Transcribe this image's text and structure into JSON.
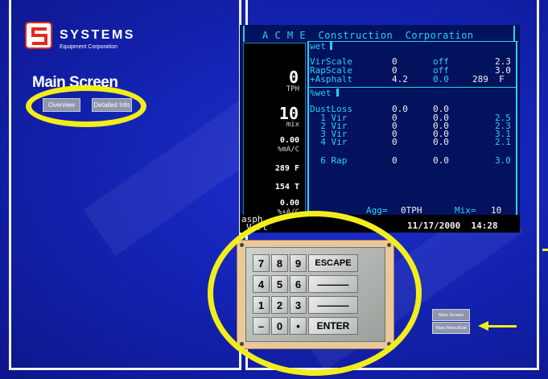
{
  "brand": {
    "name": "SYSTEMS",
    "tagline": "Equipment Corporation",
    "color": "#e12a1f"
  },
  "page_title": "Main Screen",
  "nav": {
    "overview": "Overview",
    "detailed": "Detailed Info"
  },
  "terminal": {
    "header": "A C M E  Construction  Corporation",
    "wet1": "wet",
    "wet2": "%wet",
    "rows_top": [
      {
        "name": "VirScale",
        "v1": "0",
        "v2": "off",
        "v3": "2.3"
      },
      {
        "name": "RapScale",
        "v1": "0",
        "v2": "off",
        "v3": "3.0"
      },
      {
        "name": "+Asphalt",
        "v1": "4.2",
        "v2": "0.0",
        "v3": "289  F"
      }
    ],
    "rows_bottom": [
      {
        "name": "DustLoss",
        "v1": "0.0",
        "v2": "0.0",
        "v3": ""
      },
      {
        "name": "  1 Vir",
        "v1": "0",
        "v2": "0.0",
        "v3": "2.5"
      },
      {
        "name": "  2 Vir",
        "v1": "0",
        "v2": "0.0",
        "v3": "2.3"
      },
      {
        "name": "  3 Vir",
        "v1": "0",
        "v2": "0.0",
        "v3": "3.1"
      },
      {
        "name": "  4 Vir",
        "v1": "0",
        "v2": "0.0",
        "v3": "2.1"
      },
      {
        "name": "  6 Rap",
        "v1": "0",
        "v2": "0.0",
        "v3": "3.0"
      }
    ],
    "left_panel": {
      "tph_value": "0",
      "tph_label": "TPH",
      "mix_value": "10",
      "mix_label": "mix",
      "mac_value": "0.00",
      "mac_label": "%mA/C",
      "temp": "289 F",
      "tons": "154 T",
      "ac_value": "0.00",
      "ac_label": "%+A/C"
    },
    "agg_label": "Agg=",
    "agg_value": "0TPH",
    "mix_label": "Mix=",
    "mix_value": "10",
    "status_left1": "asph",
    "status_left2": "Vert",
    "datetime": "11/17/2000  14:28"
  },
  "keypad": {
    "rows": [
      [
        "7",
        "8",
        "9",
        "ESCAPE"
      ],
      [
        "4",
        "5",
        "6",
        "———"
      ],
      [
        "1",
        "2",
        "3",
        "———"
      ],
      [
        "–",
        "0",
        "•",
        "ENTER"
      ]
    ]
  },
  "side_buttons": {
    "main_screen": "Main Screen",
    "main_menu_exit": "Main Menu/Exit"
  },
  "colors": {
    "background": "#1424b4",
    "highlight": "#f2ee1a",
    "terminal_bg": "#02125c",
    "terminal_text": "#26d2ee"
  }
}
